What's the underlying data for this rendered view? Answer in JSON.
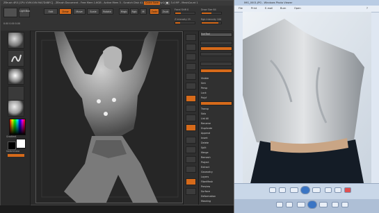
{
  "zbrush": {
    "title": "ZBrush 4R3 [CPU VVM-VVN MA7D4BFC] - ZBrush Document - Free Mem 1.6GB - Active Mem 3 - Scratch Disk 41 - Timer 3 - PolyCount 3.4 MP - MeshCount 1",
    "menu_highlight": "Quick Save",
    "top": {
      "btn1": "Edit",
      "btn2": "Draw",
      "btn3": "Move",
      "btn4": "Scale",
      "btn5": "Rotate",
      "mrgb": "Mrgb",
      "rgb": "Rgb",
      "m": "M",
      "zadd": "Zadd",
      "zsub": "Zsub",
      "focal_label": "Focal Shift 0",
      "draw_size_label": "Draw Size 64",
      "z_intensity_label": "Z Intensity 25",
      "rgb_intensity_label": "Rgb Intensity 100",
      "focal_level": 0.3,
      "draw_level": 0.5,
      "zint_level": 0.25,
      "rgbint_level": 0.85
    },
    "left": {
      "lightbox": "LightBox",
      "coords": "0.00 0.00 0.00",
      "gradient": "Gradient",
      "switch": "SwitchColor",
      "alternate": "Alternate"
    },
    "tray": {
      "title": "SubTool",
      "items": [
        "Visible",
        "Smt",
        "Persp",
        "Lock",
        "Polyf",
        "Transp",
        "Solo",
        "List All",
        "Rename",
        "Duplicate",
        "Append",
        "Insert",
        "Delete",
        "Split",
        "Merge",
        "Remesh",
        "Project",
        "Extract",
        "Geometry",
        "Layers",
        "FiberMesh",
        "Preview",
        "Surface",
        "Deformation",
        "Masking",
        "Visibility",
        "Polygroups",
        "Contact",
        "Morph Target",
        "Polypaint",
        "UV Map",
        "Texture Map",
        "Displacement Map",
        "Normal Map",
        "Vector Displacement",
        "Display Properties",
        "Unified Skin",
        "Import",
        "Export"
      ]
    },
    "colors": {
      "accent": "#d66a1a",
      "panel": "#2b2b2b"
    }
  },
  "viewer": {
    "title": "IMG_0001.JPG - Windows Photo Viewer",
    "menu": [
      "File",
      "Print",
      "E-mail",
      "Burn",
      "Open"
    ],
    "controls": [
      "zoom",
      "fit",
      "previous",
      "play-slideshow",
      "next",
      "rotate-left",
      "rotate-right",
      "delete"
    ]
  }
}
